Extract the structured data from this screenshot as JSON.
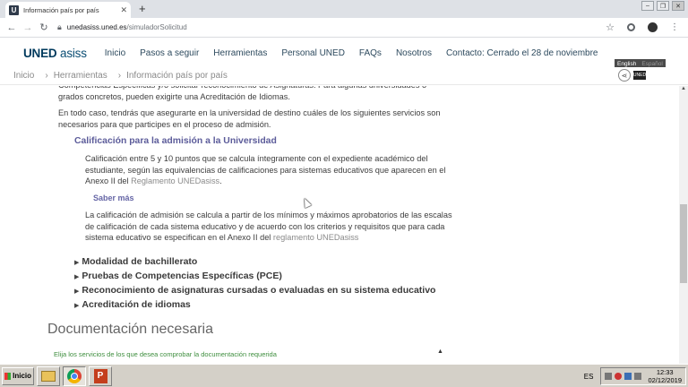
{
  "browser": {
    "tab_title": "Información país por país",
    "tab_favicon": "U",
    "url_host": "unedasiss.uned.es",
    "url_path": "/simuladorSolicitud"
  },
  "site": {
    "logo_main": "UNED",
    "logo_sub": "asiss",
    "nav": [
      "Inicio",
      "Pasos a seguir",
      "Herramientas",
      "Personal UNED",
      "FAQs",
      "Nosotros",
      "Contacto: Cerrado el 28 de noviembre"
    ],
    "lang": {
      "active": "English",
      "inactive": "Español"
    },
    "uned_badge": "UNED",
    "breadcrumbs": [
      "Inicio",
      "Herramientas",
      "Información país por país"
    ]
  },
  "content": {
    "p1": "Competencias Específicas y/o solicitar reconocimiento de Asignaturas. Para algunas universidades o grados concretos, pueden exigirte una Acreditación de Idiomas.",
    "p2": "En todo caso, tendrás que asegurarte en la universidad de destino cuáles de los siguientes servicios son necesarios para que participes en el proceso de admisión.",
    "section_title": "Calificación para la admisión a la Universidad",
    "p3_text": "Calificación entre 5 y 10 puntos que se calcula íntegramente con el expediente académico del estudiante, según las equivalencias de calificaciones para sistemas educativos que aparecen en el Anexo II del ",
    "p3_link": "Reglamento UNEDasiss",
    "p3_end": ".",
    "saber_mas": "Saber más",
    "p4_text": "La calificación de admisión se calcula a partir de los mínimos y máximos aprobatorios de las escalas de calificación de cada sistema educativo y de acuerdo con los criterios y requisitos que para cada sistema educativo se especifican en el Anexo II del ",
    "p4_link": "reglamento UNEDasiss",
    "collapsibles": [
      "Modalidad de bachillerato",
      "Pruebas de Competencias Específicas (PCE)",
      "Reconocimiento de asignaturas cursadas o evaluadas en su sistema educativo",
      "Acreditación de idiomas"
    ],
    "doc_heading": "Documentación necesaria",
    "doc_sub": "Elija los servicios de los que desea comprobar la documentación requerida"
  },
  "taskbar": {
    "start_label": "Inicio",
    "lang": "ES",
    "time": "12:33",
    "date": "02/12/2019"
  }
}
